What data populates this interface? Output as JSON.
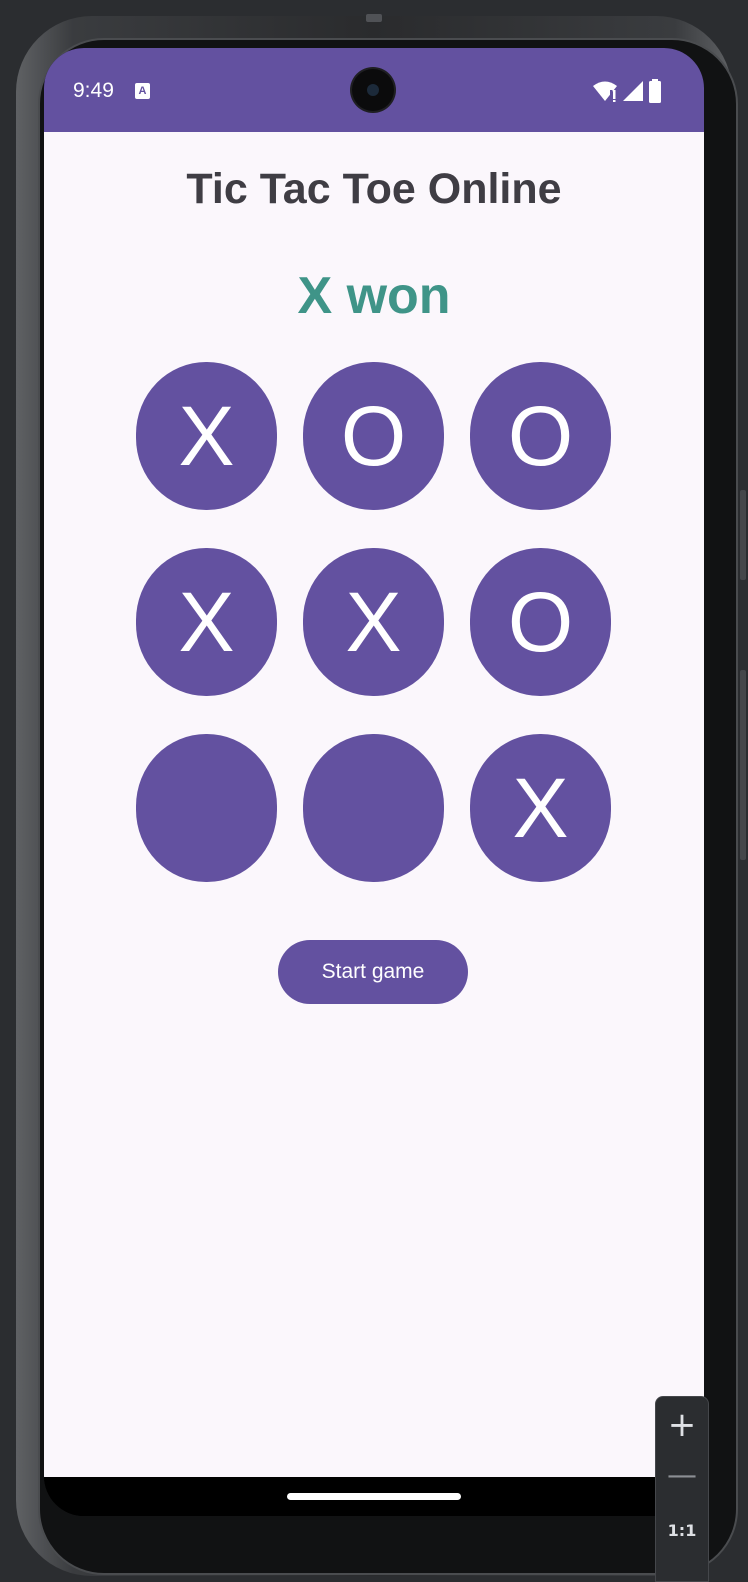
{
  "status_bar": {
    "time": "9:49",
    "left_icon": "a-icon",
    "right_icons": [
      "wifi-icon",
      "signal-icon",
      "battery-icon"
    ]
  },
  "app": {
    "title": "Tic Tac Toe Online",
    "result": "X won",
    "board": [
      [
        "X",
        "O",
        "O"
      ],
      [
        "X",
        "X",
        "O"
      ],
      [
        "",
        "",
        "X"
      ]
    ],
    "start_label": "Start game"
  },
  "colors": {
    "accent": "#6351a0",
    "result_text": "#3f9488",
    "title_text": "#3f3d44",
    "background": "#fbf7fc"
  },
  "emulator": {
    "zoom_in": "+",
    "zoom_out": "—",
    "reset": "1:1"
  }
}
